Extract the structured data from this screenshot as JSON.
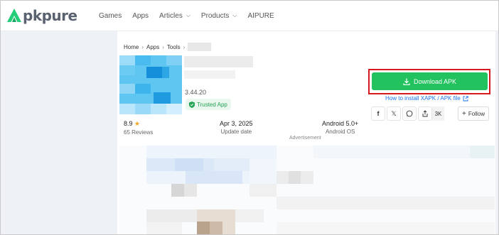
{
  "header": {
    "logo_text": "pkpure",
    "nav": [
      {
        "label": "Games",
        "dropdown": false
      },
      {
        "label": "Apps",
        "dropdown": false
      },
      {
        "label": "Articles",
        "dropdown": true
      },
      {
        "label": "Products",
        "dropdown": true
      },
      {
        "label": "AIPURE",
        "dropdown": false
      }
    ]
  },
  "breadcrumb": {
    "home": "Home",
    "apps": "Apps",
    "tools": "Tools"
  },
  "app": {
    "version": "3.44.20",
    "trusted_label": "Trusted App"
  },
  "stats": {
    "rating": "8.9",
    "reviews": "65 Reviews",
    "update_value": "Apr 3, 2025",
    "update_label": "Update date",
    "os_value": "Android 5.0+",
    "os_label": "Android OS"
  },
  "ad_label": "Advertisement",
  "download": {
    "button_label": "Download APK",
    "howto_label": "How to install XAPK / APK file"
  },
  "share": {
    "facebook_glyph": "f",
    "x_glyph": "𝕏",
    "count": "3K",
    "follow_label": "Follow"
  },
  "colors": {
    "brand_green": "#24cd77",
    "download_green": "#22c25f",
    "highlight_red": "#d71920",
    "link_blue": "#1a73e8"
  }
}
